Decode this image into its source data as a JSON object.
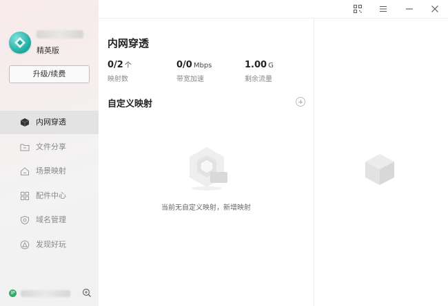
{
  "sidebar": {
    "edition": "精英版",
    "upgrade_label": "升级/续费",
    "items": [
      {
        "label": "内网穿透",
        "icon": "cube-icon",
        "active": true
      },
      {
        "label": "文件分享",
        "icon": "folder-share-icon"
      },
      {
        "label": "场景映射",
        "icon": "house-icon"
      },
      {
        "label": "配件中心",
        "icon": "grid-icon"
      },
      {
        "label": "域名管理",
        "icon": "shield-icon"
      },
      {
        "label": "发现好玩",
        "icon": "triangle-icon"
      }
    ],
    "ip_badge": "IP"
  },
  "main": {
    "title": "内网穿透",
    "stats": [
      {
        "value": "0/2",
        "unit": "个",
        "caption": "映射数"
      },
      {
        "value": "0/0",
        "unit": "Mbps",
        "caption": "带宽加速"
      },
      {
        "value": "1.00",
        "unit": "G",
        "caption": "剩余流量"
      }
    ],
    "section_title": "自定义映射",
    "empty_text": "当前无自定义映射，",
    "empty_link": "新增映射"
  }
}
